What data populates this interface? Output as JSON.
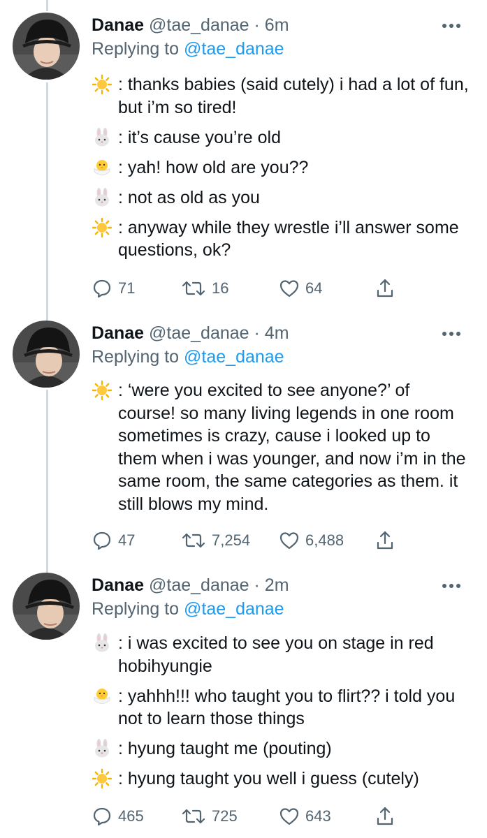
{
  "tweets": [
    {
      "name": "Danae",
      "handle": "@tae_danae",
      "dot": "·",
      "time": "6m",
      "replying_prefix": "Replying to",
      "replying_to": "@tae_danae",
      "lines": [
        {
          "emoji": "sun-emoji",
          "text": ": thanks babies (said cutely) i had a lot of fun, but i’m so tired!"
        },
        {
          "emoji": "rabbit-emoji",
          "text": ": it’s cause you’re old"
        },
        {
          "emoji": "chick-emoji",
          "text": ": yah! how old are you??"
        },
        {
          "emoji": "rabbit-emoji",
          "text": ": not as old as you"
        },
        {
          "emoji": "sun-emoji",
          "text": ": anyway while they wrestle i’ll answer some questions, ok?"
        }
      ],
      "replies": "71",
      "retweets": "16",
      "likes": "64"
    },
    {
      "name": "Danae",
      "handle": "@tae_danae",
      "dot": "·",
      "time": "4m",
      "replying_prefix": "Replying to",
      "replying_to": "@tae_danae",
      "lines": [
        {
          "emoji": "sun-emoji",
          "text": ": ‘were you excited to see anyone?’ of course! so many living legends in one room sometimes is crazy, cause i looked up to them when i was younger, and now i’m in the same room, the same categories as them. it still blows my mind."
        }
      ],
      "replies": "47",
      "retweets": "7,254",
      "likes": "6,488"
    },
    {
      "name": "Danae",
      "handle": "@tae_danae",
      "dot": "·",
      "time": "2m",
      "replying_prefix": "Replying to",
      "replying_to": "@tae_danae",
      "lines": [
        {
          "emoji": "rabbit-emoji",
          "text": ": i was excited to see you on stage in red hobihyungie"
        },
        {
          "emoji": "chick-emoji",
          "text": ": yahhh!!! who taught you to flirt?? i told you not to learn those things"
        },
        {
          "emoji": "rabbit-emoji",
          "text": ": hyung taught me (pouting)"
        },
        {
          "emoji": "sun-emoji",
          "text": ": hyung taught you well i guess (cutely)"
        }
      ],
      "replies": "465",
      "retweets": "725",
      "likes": "643"
    }
  ],
  "icons": {
    "reply": "reply-icon",
    "retweet": "retweet-icon",
    "like": "heart-icon",
    "share": "share-icon",
    "more": "more-icon"
  },
  "colors": {
    "text": "#0f1419",
    "secondary": "#536471",
    "link": "#1d9bf0",
    "thread_line": "#cfd9de"
  }
}
